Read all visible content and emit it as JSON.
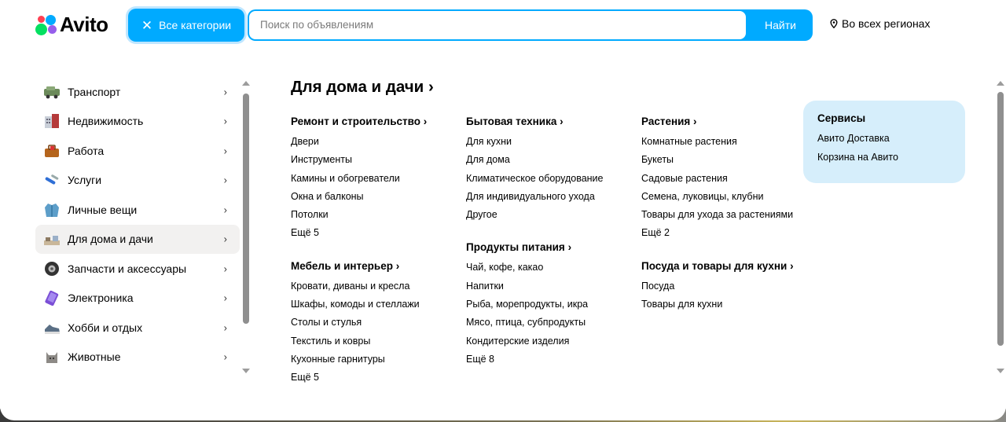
{
  "header": {
    "logo_text": "Avito",
    "categories_button": "Все категории",
    "search_placeholder": "Поиск по объявлениям",
    "search_button": "Найти",
    "region": "Во всех регионах"
  },
  "sidebar": {
    "items": [
      {
        "label": "Транспорт",
        "icon": "car-icon"
      },
      {
        "label": "Недвижимость",
        "icon": "building-icon"
      },
      {
        "label": "Работа",
        "icon": "briefcase-icon"
      },
      {
        "label": "Услуги",
        "icon": "tools-icon"
      },
      {
        "label": "Личные вещи",
        "icon": "jacket-icon"
      },
      {
        "label": "Для дома и дачи",
        "icon": "house-items-icon",
        "active": true
      },
      {
        "label": "Запчасти и аксессуары",
        "icon": "tire-icon"
      },
      {
        "label": "Электроника",
        "icon": "phone-icon"
      },
      {
        "label": "Хобби и отдых",
        "icon": "sneaker-icon"
      },
      {
        "label": "Животные",
        "icon": "cat-icon"
      }
    ]
  },
  "main": {
    "title": "Для дома и дачи",
    "columns": [
      [
        {
          "title": "Ремонт и строительство",
          "links": [
            "Двери",
            "Инструменты",
            "Камины и обогреватели",
            "Окна и балконы",
            "Потолки",
            "Ещё 5"
          ]
        },
        {
          "title": "Мебель и интерьер",
          "links": [
            "Кровати, диваны и кресла",
            "Шкафы, комоды и стеллажи",
            "Столы и стулья",
            "Текстиль и ковры",
            "Кухонные гарнитуры",
            "Ещё 5"
          ]
        }
      ],
      [
        {
          "title": "Бытовая техника",
          "links": [
            "Для кухни",
            "Для дома",
            "Климатическое оборудование",
            "Для индивидуального ухода",
            "Другое"
          ]
        },
        {
          "title": "Продукты питания",
          "links": [
            "Чай, кофе, какао",
            "Напитки",
            "Рыба, морепродукты, икра",
            "Мясо, птица, субпродукты",
            "Кондитерские изделия",
            "Ещё 8"
          ]
        }
      ],
      [
        {
          "title": "Растения",
          "links": [
            "Комнатные растения",
            "Букеты",
            "Садовые растения",
            "Семена, луковицы, клубни",
            "Товары для ухода за растениями",
            "Ещё 2"
          ]
        },
        {
          "title": "Посуда и товары для кухни",
          "links": [
            "Посуда",
            "Товары для кухни"
          ]
        }
      ]
    ]
  },
  "services": {
    "title": "Сервисы",
    "links": [
      "Авито Доставка",
      "Корзина на Авито"
    ]
  },
  "colors": {
    "accent": "#00aaff",
    "services_bg": "#d6eefb",
    "active_item_bg": "#f2f1f0"
  }
}
